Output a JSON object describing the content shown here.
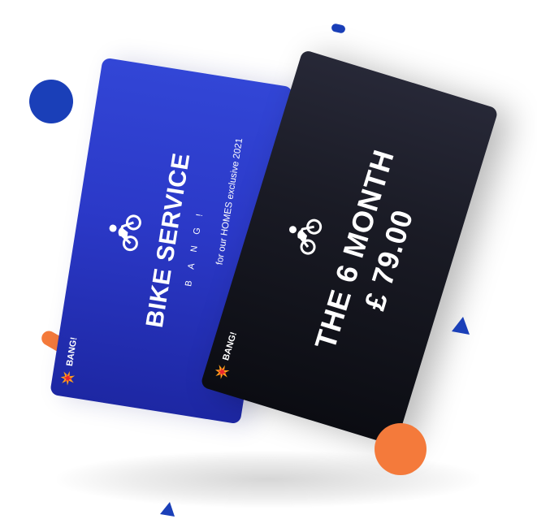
{
  "colors": {
    "brand_blue": "#1a3fb8",
    "card_blue": "#2b39c8",
    "card_dark": "#12131b",
    "accent_orange": "#f47a3b"
  },
  "blue_card": {
    "title": "BIKE SERVICE",
    "subtitle": "BANG!",
    "exclusive_text": "for our HOMES exclusive 2021",
    "bang_label": "BANG!",
    "icon": "cyclist-icon",
    "bang_icon": "collision-icon"
  },
  "dark_card": {
    "title": "THE 6 MONTH",
    "price": "£ 79.00",
    "bang_label": "BANG!",
    "icon": "cyclist-icon",
    "bang_icon": "collision-icon"
  }
}
